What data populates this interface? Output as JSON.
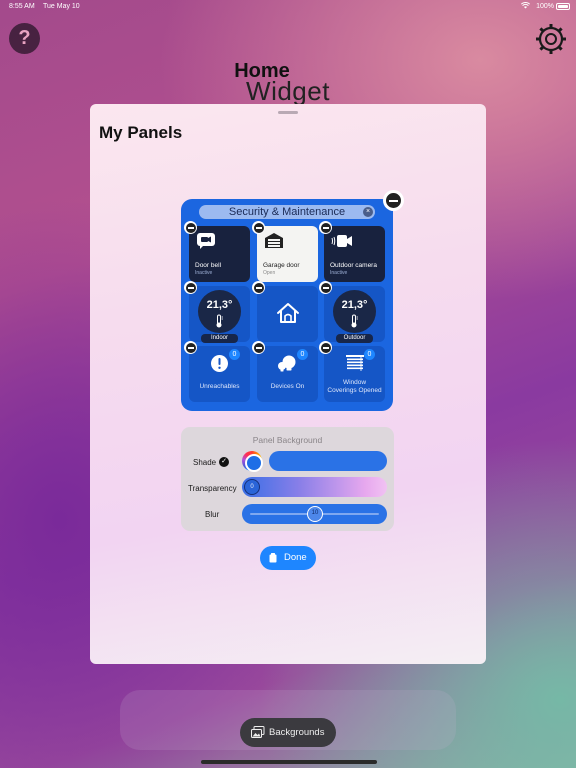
{
  "status_bar": {
    "time": "8:55 AM",
    "date": "Tue May 10",
    "battery": "100%"
  },
  "header": {
    "help_label": "?",
    "title_line1": "Home",
    "title_line2": "Widget"
  },
  "sheet": {
    "title": "My Panels"
  },
  "panel": {
    "title": "Security & Maintenance",
    "title_clear": "×",
    "accent": "#1b66e0",
    "tiles": {
      "door_bell": {
        "name": "Door bell",
        "status": "Inactive",
        "icon": "video-doorbell-icon"
      },
      "garage_door": {
        "name": "Garage door",
        "status": "Open",
        "icon": "garage-icon"
      },
      "outdoor_camera": {
        "name": "Outdoor camera",
        "status": "Inactive",
        "icon": "camera-icon"
      },
      "indoor_temp": {
        "value": "21,3°",
        "label": "Indoor",
        "icon": "thermometer-icon"
      },
      "home": {
        "icon": "house-icon"
      },
      "outdoor_temp": {
        "value": "21,3°",
        "label": "Outdoor",
        "icon": "thermometer-icon"
      },
      "unreachables": {
        "label": "Unreachables",
        "count": "0",
        "icon": "warning-icon"
      },
      "devices_on": {
        "label": "Devices On",
        "count": "0",
        "icon": "lightbulb-icon"
      },
      "window_coverings": {
        "label_line1": "Window",
        "label_line2": "Coverings Opened",
        "count": "0",
        "icon": "blinds-icon"
      }
    }
  },
  "panel_background": {
    "title": "Panel Background",
    "shade_label": "Shade",
    "transparency_label": "Transparency",
    "transparency_value": "0",
    "blur_label": "Blur",
    "blur_value": "10",
    "blur_level": 0.5,
    "shade_color": "#2a72e6"
  },
  "done_button": {
    "label": "Done"
  },
  "backgrounds_button": {
    "label": "Backgrounds"
  }
}
